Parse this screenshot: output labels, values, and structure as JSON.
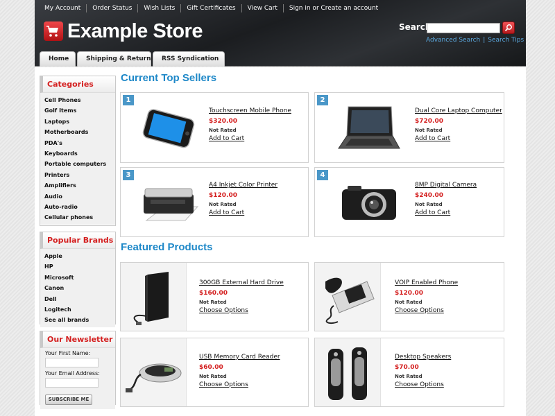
{
  "header": {
    "top_links": [
      "My Account",
      "Order Status",
      "Wish Lists",
      "Gift Certificates",
      "View Cart",
      "Sign in or Create an account"
    ],
    "store_name": "Example Store",
    "search": {
      "label": "Search",
      "value": "",
      "placeholder": ""
    },
    "search_links": {
      "advanced": "Advanced Search",
      "sep": "|",
      "tips": "Search Tips"
    },
    "tabs": [
      "Home",
      "Shipping & Returns",
      "RSS Syndication"
    ]
  },
  "sidebar": {
    "categories": {
      "title": "Categories",
      "items": [
        "Cell Phones",
        "Golf Items",
        "Laptops",
        "Motherboards",
        "PDA's",
        "Keyboards",
        "Portable computers",
        "Printers",
        "Amplifiers",
        "Audio",
        "Auto-radio",
        "Cellular phones"
      ]
    },
    "brands": {
      "title": "Popular Brands",
      "items": [
        "Apple",
        "HP",
        "Microsoft",
        "Canon",
        "Dell",
        "Logitech",
        "See all brands"
      ]
    },
    "newsletter": {
      "title": "Our Newsletter",
      "first_name_label": "Your First Name:",
      "first_name_value": "",
      "email_label": "Your Email Address:",
      "email_value": "",
      "subscribe": "SUBSCRIBE ME"
    }
  },
  "top_sellers": {
    "title": "Current Top Sellers",
    "items": [
      {
        "rank": "1",
        "name": "Touchscreen Mobile Phone",
        "price": "$320.00",
        "rating": "Not Rated",
        "action": "Add to Cart",
        "icon": "phone-image"
      },
      {
        "rank": "2",
        "name": "Dual Core Laptop Computer",
        "price": "$720.00",
        "rating": "Not Rated",
        "action": "Add to Cart",
        "icon": "laptop-image"
      },
      {
        "rank": "3",
        "name": "A4 Inkjet Color Printer",
        "price": "$120.00",
        "rating": "Not Rated",
        "action": "Add to Cart",
        "icon": "printer-image"
      },
      {
        "rank": "4",
        "name": "8MP Digital Camera",
        "price": "$240.00",
        "rating": "Not Rated",
        "action": "Add to Cart",
        "icon": "camera-image"
      }
    ]
  },
  "featured": {
    "title": "Featured Products",
    "items": [
      {
        "name": "300GB External Hard Drive",
        "price": "$160.00",
        "rating": "Not Rated",
        "action": "Choose Options",
        "icon": "hard-drive-image"
      },
      {
        "name": "VOIP Enabled Phone",
        "price": "$120.00",
        "rating": "Not Rated",
        "action": "Choose Options",
        "icon": "voip-phone-image"
      },
      {
        "name": "USB Memory Card Reader",
        "price": "$60.00",
        "rating": "Not Rated",
        "action": "Choose Options",
        "icon": "card-reader-image"
      },
      {
        "name": "Desktop Speakers",
        "price": "$70.00",
        "rating": "Not Rated",
        "action": "Choose Options",
        "icon": "speakers-image"
      }
    ]
  },
  "colors": {
    "accent_red": "#d42020",
    "title_blue": "#1e88c8",
    "link_blue": "#5ba9e0",
    "header_dark": "#1b1d20"
  }
}
